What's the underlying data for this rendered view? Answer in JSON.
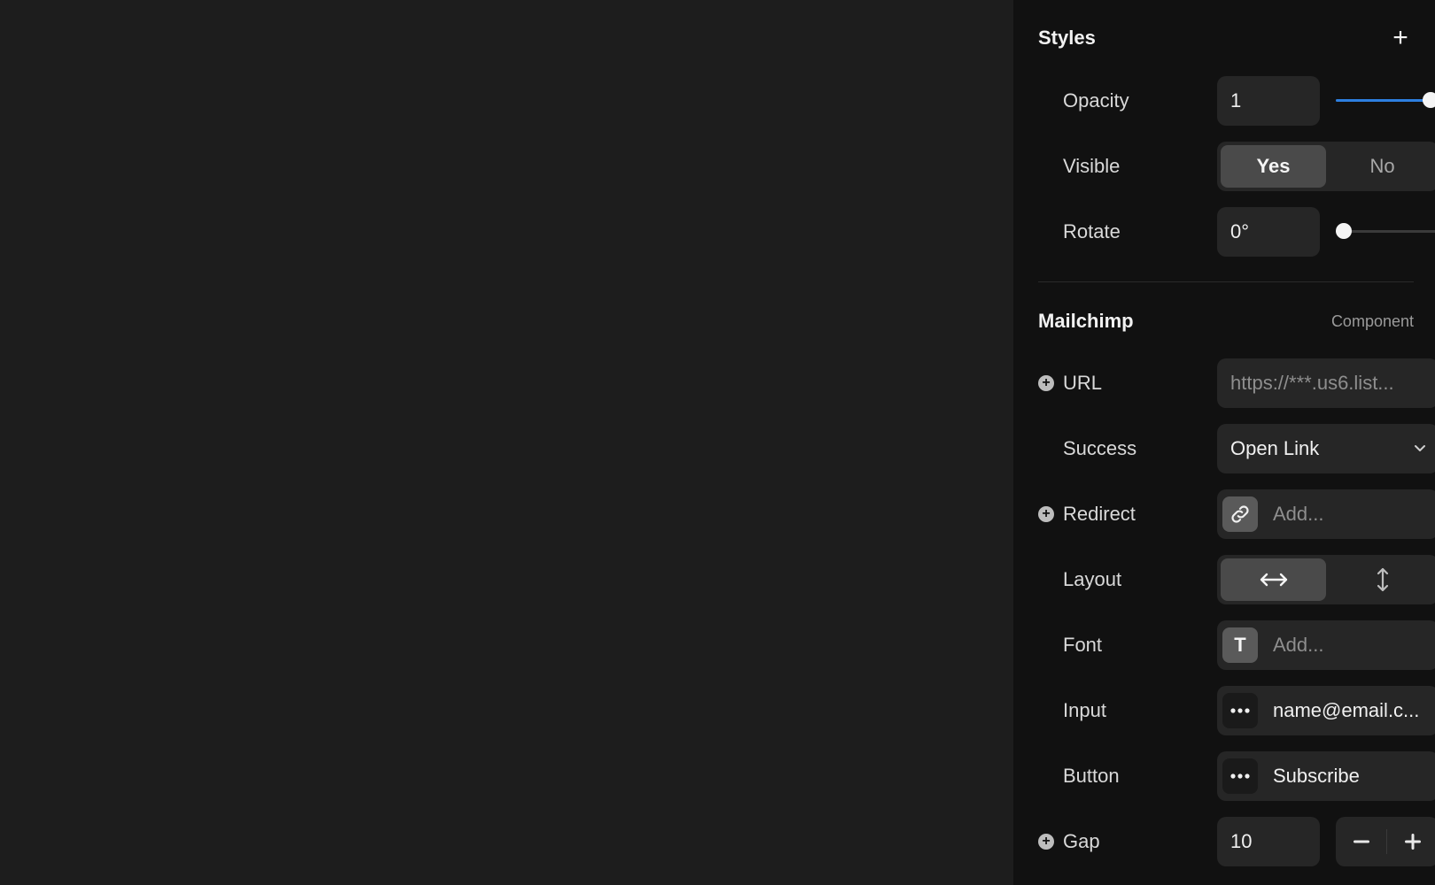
{
  "styles": {
    "title": "Styles",
    "add_icon": "plus-icon",
    "opacity": {
      "label": "Opacity",
      "value": "1",
      "slider_fraction": 1.0
    },
    "visible": {
      "label": "Visible",
      "options": [
        "Yes",
        "No"
      ],
      "selected": "Yes"
    },
    "rotate": {
      "label": "Rotate",
      "value": "0°",
      "slider_fraction": 0.0
    }
  },
  "mailchimp": {
    "title": "Mailchimp",
    "subtitle": "Component",
    "url": {
      "label": "URL",
      "value": "https://***.us6.list..."
    },
    "success": {
      "label": "Success",
      "value": "Open Link"
    },
    "redirect": {
      "label": "Redirect",
      "placeholder": "Add...",
      "icon": "link-icon"
    },
    "layout": {
      "label": "Layout",
      "options": [
        "horizontal-arrows-icon",
        "vertical-arrows-icon"
      ],
      "selected": "horizontal-arrows-icon"
    },
    "font": {
      "label": "Font",
      "placeholder": "Add...",
      "icon": "text-t-icon"
    },
    "input": {
      "label": "Input",
      "value": "name@email.c...",
      "icon": "more-dots-icon"
    },
    "button": {
      "label": "Button",
      "value": "Subscribe",
      "icon": "more-dots-icon"
    },
    "gap": {
      "label": "Gap",
      "value": "10"
    }
  },
  "colors": {
    "accent": "#2d7fe0",
    "panel_bg": "#111111",
    "canvas_bg": "#1d1d1d",
    "field_bg": "#262626"
  }
}
